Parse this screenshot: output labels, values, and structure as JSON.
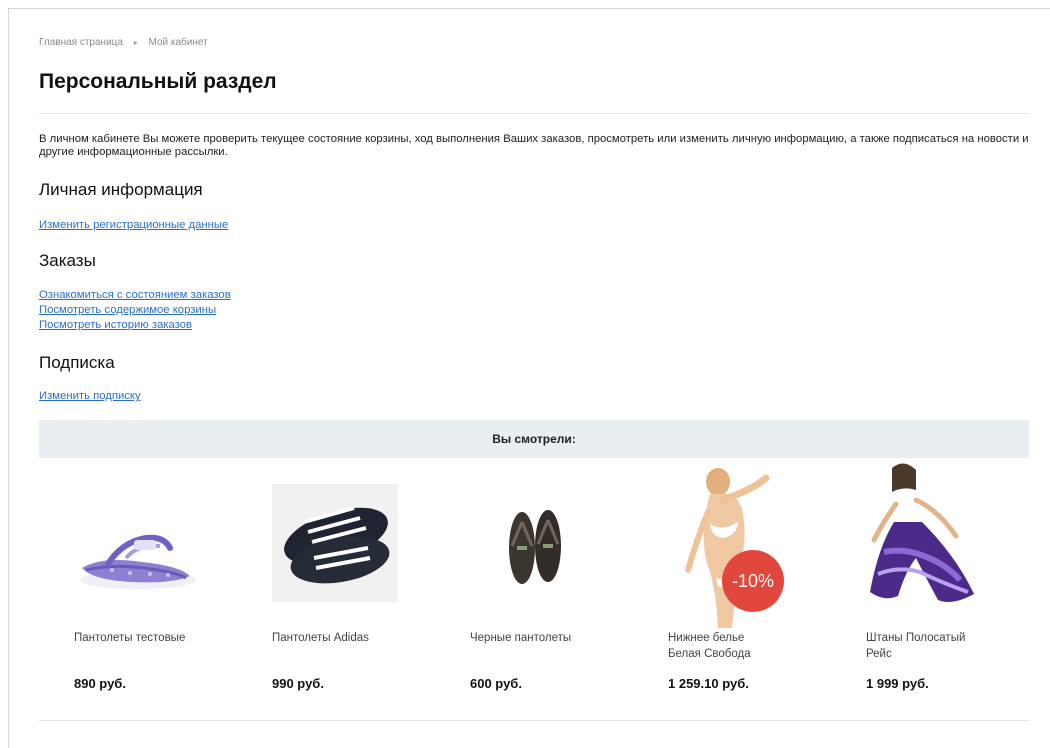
{
  "breadcrumb": {
    "home": "Главная страница",
    "current": "Мой кабинет"
  },
  "page_title": "Персональный раздел",
  "intro": "В личном кабинете Вы можете проверить текущее состояние корзины, ход выполнения Ваших заказов, просмотреть или изменить личную информацию, а также подписаться на новости и другие информационные рассылки.",
  "sections": {
    "personal": {
      "title": "Личная информация",
      "links": [
        "Изменить регистрационные данные"
      ]
    },
    "orders": {
      "title": "Заказы",
      "links": [
        "Ознакомиться с состоянием заказов",
        "Посмотреть содержимое корзины",
        "Посмотреть историю заказов"
      ]
    },
    "subscription": {
      "title": "Подписка",
      "links": [
        "Изменить подписку"
      ]
    }
  },
  "viewed": {
    "title": "Вы смотрели:",
    "products": [
      {
        "name": "Пантолеты тестовые",
        "price": "890 руб."
      },
      {
        "name": "Пантолеты Adidas",
        "price": "990 руб."
      },
      {
        "name": "Черные пантолеты",
        "price": "600 руб."
      },
      {
        "name": "Нижнее белье Белая Свобода",
        "price": "1 259.10 руб.",
        "badge": "-10%"
      },
      {
        "name": "Штаны Полосатый Рейс",
        "price": "1 999 руб."
      }
    ]
  },
  "colors": {
    "link": "#2a6fc7",
    "viewed_bar_bg": "#e9eef3",
    "sale_badge": "#e2473d"
  }
}
